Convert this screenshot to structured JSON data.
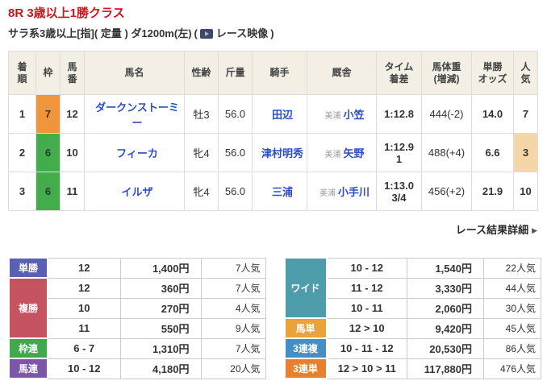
{
  "header": {
    "race_title": "8R 3歳以上1勝クラス",
    "conditions": "サラ系3歳以上[指]( 定量 ) ダ1200m(左)",
    "video_paren_open": "(",
    "video_label": "レース映像",
    "video_paren_close": ")"
  },
  "colors": {
    "title_red": "#cf121b",
    "frame7_orange": "#f0953c",
    "frame6_green": "#43ad4c",
    "popularity_highlight": "#f5d7a7",
    "link_blue": "#2b4ec2"
  },
  "results": {
    "headers": [
      {
        "lines": [
          "着",
          "順"
        ]
      },
      {
        "lines": [
          "枠"
        ]
      },
      {
        "lines": [
          "馬",
          "番"
        ]
      },
      {
        "lines": [
          "馬名"
        ]
      },
      {
        "lines": [
          "性齢"
        ]
      },
      {
        "lines": [
          "斤量"
        ]
      },
      {
        "lines": [
          "騎手"
        ]
      },
      {
        "lines": [
          "厩舎"
        ]
      },
      {
        "lines": [
          "タイム",
          "着差"
        ]
      },
      {
        "lines": [
          "馬体重",
          "(増減)"
        ]
      },
      {
        "lines": [
          "単勝",
          "オッズ"
        ]
      },
      {
        "lines": [
          "人",
          "気"
        ]
      }
    ],
    "rows": [
      {
        "finish": "1",
        "frame": "7",
        "frame_color": "#f0953c",
        "number": "12",
        "horse": "ダークンストーミー",
        "sex_age": "牡3",
        "weight": "56.0",
        "jockey": "田辺",
        "region": "美浦",
        "stable": "小笠",
        "time": "1:12.8",
        "margin": "",
        "body_weight": "444(-2)",
        "odds": "14.0",
        "popularity": "7",
        "pop_bg": ""
      },
      {
        "finish": "2",
        "frame": "6",
        "frame_color": "#43ad4c",
        "number": "10",
        "horse": "フィーカ",
        "sex_age": "牝4",
        "weight": "56.0",
        "jockey": "津村明秀",
        "region": "美浦",
        "stable": "矢野",
        "time": "1:12.9",
        "margin": "1",
        "body_weight": "488(+4)",
        "odds": "6.6",
        "popularity": "3",
        "pop_bg": "#f5d7a7"
      },
      {
        "finish": "3",
        "frame": "6",
        "frame_color": "#43ad4c",
        "number": "11",
        "horse": "イルザ",
        "sex_age": "牝4",
        "weight": "56.0",
        "jockey": "三浦",
        "region": "美浦",
        "stable": "小手川",
        "time": "1:13.0",
        "margin": "3/4",
        "body_weight": "456(+2)",
        "odds": "21.9",
        "popularity": "10",
        "pop_bg": ""
      }
    ]
  },
  "detail_link": {
    "label": "レース結果詳細",
    "arrow": "▶"
  },
  "payout_left": {
    "groups": [
      {
        "label": "単勝",
        "color": "#5a61b4"
      },
      {
        "label": "複勝",
        "color": "#c65360"
      },
      {
        "label": "枠連",
        "color": "#41a94b"
      },
      {
        "label": "馬連",
        "color": "#7c57a9"
      }
    ],
    "rows": [
      {
        "combo": "12",
        "amount": "1,400円",
        "pop": "7人気"
      },
      {
        "combo": "12",
        "amount": "360円",
        "pop": "7人気"
      },
      {
        "combo": "10",
        "amount": "270円",
        "pop": "4人気"
      },
      {
        "combo": "11",
        "amount": "550円",
        "pop": "9人気"
      },
      {
        "combo": "6 - 7",
        "amount": "1,310円",
        "pop": "7人気"
      },
      {
        "combo": "10 - 12",
        "amount": "4,180円",
        "pop": "20人気"
      }
    ]
  },
  "payout_right": {
    "groups": [
      {
        "label": "ワイド",
        "color": "#4d9dab"
      },
      {
        "label": "馬単",
        "color": "#eaa339"
      },
      {
        "label": "3連複",
        "color": "#468fc6"
      },
      {
        "label": "3連単",
        "color": "#e8812e"
      }
    ],
    "rows": [
      {
        "combo": "10 - 12",
        "amount": "1,540円",
        "pop": "22人気"
      },
      {
        "combo": "11 - 12",
        "amount": "3,330円",
        "pop": "44人気"
      },
      {
        "combo": "10 - 11",
        "amount": "2,060円",
        "pop": "30人気"
      },
      {
        "combo": "12 > 10",
        "amount": "9,420円",
        "pop": "45人気"
      },
      {
        "combo": "10 - 11 - 12",
        "amount": "20,530円",
        "pop": "86人気"
      },
      {
        "combo": "12 > 10 > 11",
        "amount": "117,880円",
        "pop": "476人気"
      }
    ]
  }
}
